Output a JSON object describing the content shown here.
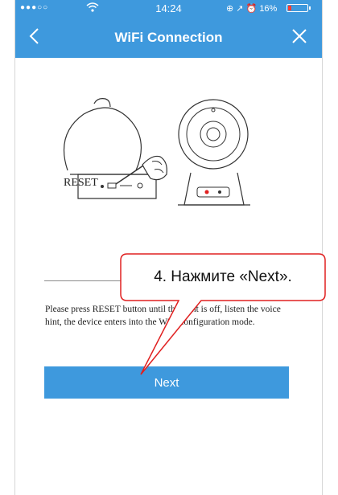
{
  "status_bar": {
    "signal": "●●●○○",
    "time": "14:24",
    "sys_icons": "⊕ ↗ ⏰",
    "battery_text": "16%",
    "battery_level": 0.16
  },
  "navbar": {
    "title": "WiFi Connection",
    "back_icon": "chevron-left-icon",
    "close_icon": "close-icon"
  },
  "illustration": {
    "reset_label": "RESET"
  },
  "instruction_text": "Please press RESET button until the light is off, listen the voice hint, the device enters into the WiFi configuration mode.",
  "next_label": "Next",
  "callout": {
    "text": "4. Нажмите «Next»."
  },
  "colors": {
    "accent": "#3e99dd",
    "callout_border": "#e02020"
  }
}
